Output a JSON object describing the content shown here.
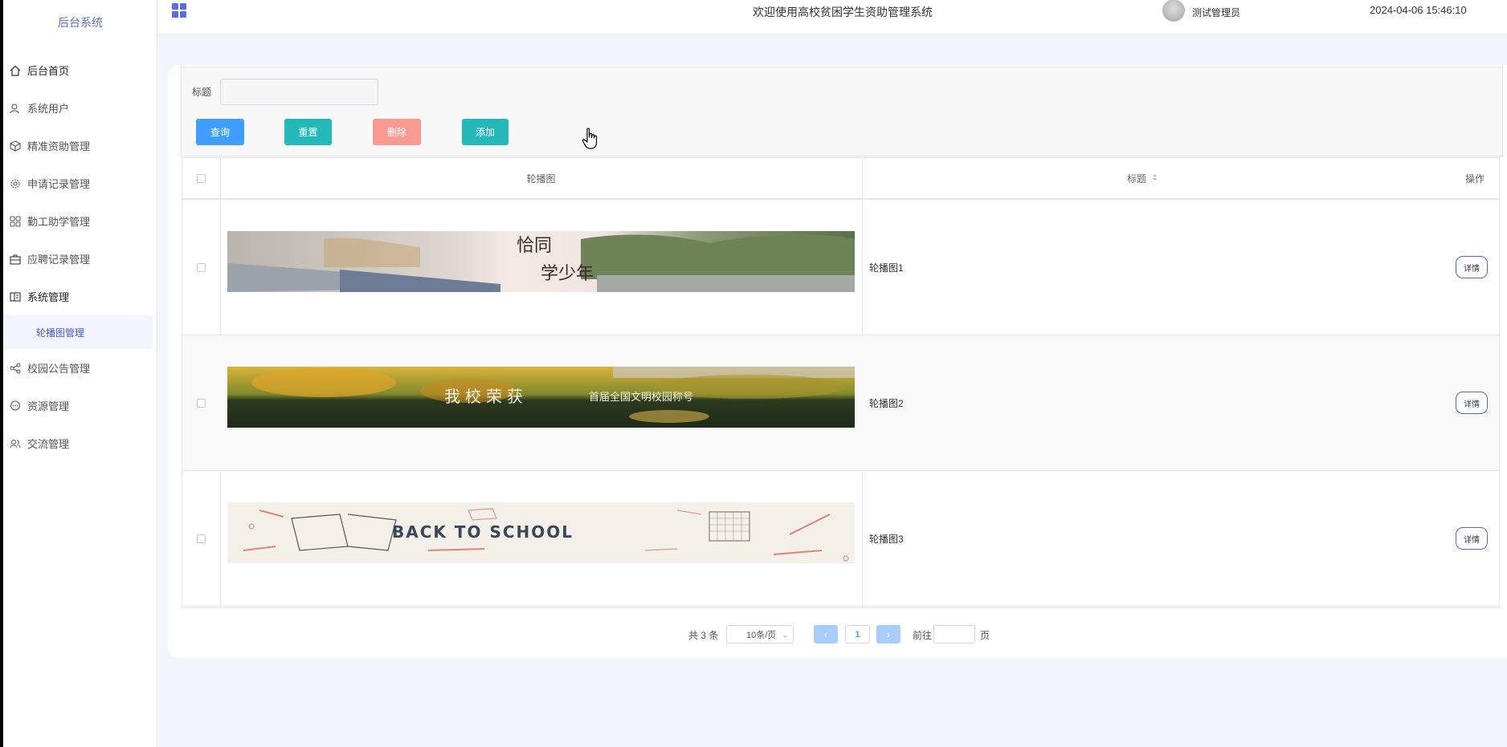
{
  "sidebar": {
    "brand": "后台系统",
    "items": [
      {
        "label": "后台首页",
        "icon": "home-icon"
      },
      {
        "label": "系统用户",
        "icon": "user-icon"
      },
      {
        "label": "精准资助管理",
        "icon": "cube-icon"
      },
      {
        "label": "申请记录管理",
        "icon": "gear-icon"
      },
      {
        "label": "勤工助学管理",
        "icon": "grid-icon"
      },
      {
        "label": "应聘记录管理",
        "icon": "briefcase-icon"
      },
      {
        "label": "系统管理",
        "icon": "panel-icon"
      },
      {
        "label": "校园公告管理",
        "icon": "share-icon"
      },
      {
        "label": "资源管理",
        "icon": "chat-icon"
      },
      {
        "label": "交流管理",
        "icon": "users-icon"
      }
    ],
    "sub_item": "轮播图管理"
  },
  "header": {
    "title": "欢迎使用高校贫困学生资助管理系统",
    "user": "测试管理员",
    "datetime": "2024-04-06 15:46:10"
  },
  "filter": {
    "label": "标题",
    "value": "",
    "search_label": "查询",
    "reset_label": "重置",
    "delete_label": "删除",
    "add_label": "添加"
  },
  "table": {
    "columns": [
      "轮播图",
      "标题",
      "操作"
    ],
    "rows": [
      {
        "title": "轮播图1",
        "action": "详情"
      },
      {
        "title": "轮播图2",
        "action": "详情"
      },
      {
        "title": "轮播图3",
        "action": "详情"
      }
    ]
  },
  "pagination": {
    "total": "共 3 条",
    "page_size": "10条/页",
    "current_page": "1",
    "goto_prefix": "前往",
    "goto_suffix": "页"
  },
  "colors": {
    "primary": "#409eff",
    "teal": "#25b8b8",
    "danger_light": "#fa9a92",
    "brand": "#5b6dd6"
  }
}
